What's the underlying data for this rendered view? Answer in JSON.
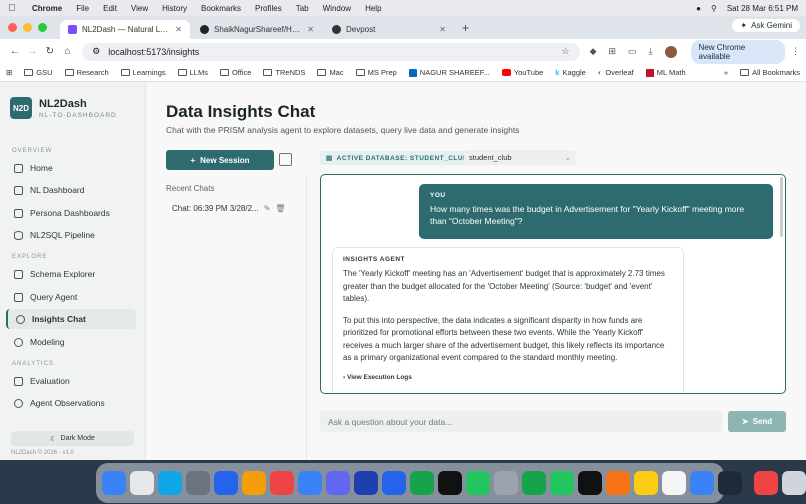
{
  "menubar": {
    "app": "Chrome",
    "items": [
      "File",
      "Edit",
      "View",
      "History",
      "Bookmarks",
      "Profiles",
      "Tab",
      "Window",
      "Help"
    ],
    "clock": "Sat 28 Mar  6:51 PM"
  },
  "tabs": [
    {
      "title": "NL2Dash — Natural Language",
      "color": "#7c4dff"
    },
    {
      "title": "ShaikNagurShareef/Hacklan",
      "color": "#222"
    },
    {
      "title": "Devpost",
      "color": "#333"
    }
  ],
  "ask_gemini": "Ask Gemini",
  "address": {
    "url": "localhost:5173/insights",
    "new_chrome": "New Chrome available"
  },
  "bookmarks": [
    "GSU",
    "Research",
    "Learnings",
    "LLMs",
    "Office",
    "TReNDS",
    "Mac",
    "MS Prep",
    "NAGUR SHAREEF...",
    "YouTube",
    "Kaggle",
    "Overleaf",
    "ML Math"
  ],
  "all_bookmarks": "All Bookmarks",
  "sidebar": {
    "logo_badge": "N2D",
    "logo_title": "NL2Dash",
    "logo_sub": "NL-TO-DASHBOARD",
    "overview_label": "OVERVIEW",
    "overview": [
      "Home",
      "NL Dashboard",
      "Persona Dashboards",
      "NL2SQL Pipeline"
    ],
    "explore_label": "EXPLORE",
    "explore": [
      "Schema Explorer",
      "Query Agent",
      "Insights Chat",
      "Modeling"
    ],
    "analytics_label": "ANALYTICS",
    "analytics": [
      "Evaluation",
      "Agent Observations"
    ],
    "dark_mode": "Dark Mode",
    "copyright": "NL2Dash © 2026 · v1.0"
  },
  "main": {
    "title": "Data Insights Chat",
    "subtitle": "Chat with the PRISM analysis agent to explore datasets, query live data and generate insights",
    "new_session": "New Session",
    "recent_label": "Recent Chats",
    "chat_item": "Chat: 06:39 PM 3/28/2...",
    "db_badge": "ACTIVE DATABASE: STUDENT_CLUB",
    "db_select": "student_club",
    "user_label": "YOU",
    "user_question": "How many times was the budget in Advertisement for \"Yearly Kickoff\" meeting more than \"October Meeting\"?",
    "agent_label": "INSIGHTS AGENT",
    "agent_p1": "The 'Yearly Kickoff' meeting has an 'Advertisement' budget that is approximately 2.73 times greater than the budget allocated for the 'October Meeting' (Source: 'budget' and 'event' tables).",
    "agent_p2": "To put this into perspective, the data indicates a significant disparity in how funds are prioritized for promotional efforts between these two events. While the 'Yearly Kickoff' receives a much larger share of the advertisement budget, this likely reflects its importance as a primary organizational event compared to the standard monthly meeting.",
    "exec_logs": "View Execution Logs",
    "input_placeholder": "Ask a question about your data...",
    "send": "Send"
  },
  "dock_colors": [
    "#3b82f6",
    "#e5e7eb",
    "#0ea5e9",
    "#6b7280",
    "#2563eb",
    "#f59e0b",
    "#ef4444",
    "#3b82f6",
    "#6366f1",
    "#1e40af",
    "#2563eb",
    "#16a34a",
    "#111",
    "#22c55e",
    "#9ca3af",
    "#16a34a",
    "#22c55e",
    "#111",
    "#f97316",
    "#facc15",
    "#f5f5f5",
    "#3b82f6",
    "#1f2937",
    "#ef4444",
    "#d1d5db"
  ]
}
